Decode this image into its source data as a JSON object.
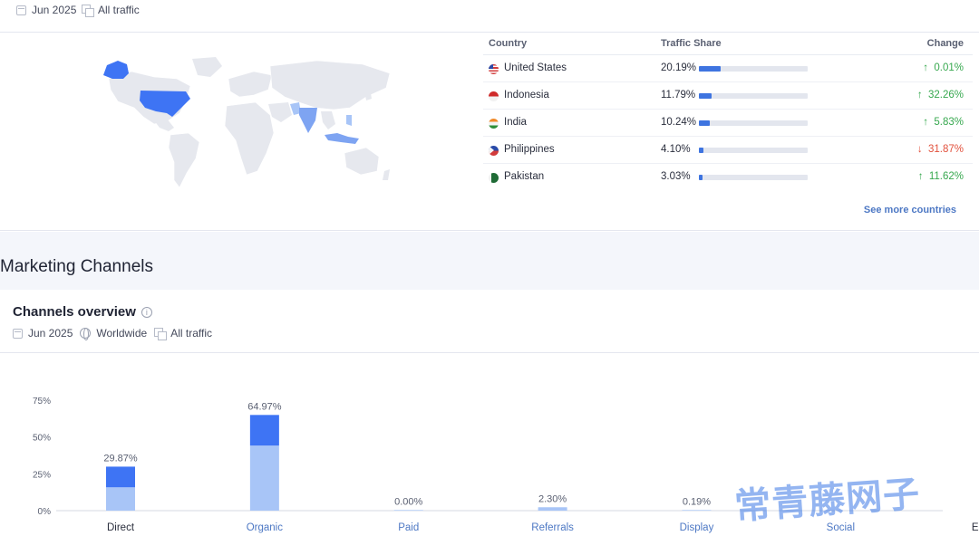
{
  "top_filters": {
    "date": "Jun 2025",
    "traffic": "All traffic"
  },
  "geo": {
    "columns": {
      "country": "Country",
      "share": "Traffic Share",
      "change": "Change"
    },
    "rows": [
      {
        "country": "United States",
        "share": "20.19%",
        "share_value": 20.19,
        "change": "0.01%",
        "direction": "up"
      },
      {
        "country": "Indonesia",
        "share": "11.79%",
        "share_value": 11.79,
        "change": "32.26%",
        "direction": "up"
      },
      {
        "country": "India",
        "share": "10.24%",
        "share_value": 10.24,
        "change": "5.83%",
        "direction": "up"
      },
      {
        "country": "Philippines",
        "share": "4.10%",
        "share_value": 4.1,
        "change": "31.87%",
        "direction": "down"
      },
      {
        "country": "Pakistan",
        "share": "3.03%",
        "share_value": 3.03,
        "change": "11.62%",
        "direction": "up"
      }
    ],
    "see_more": "See more countries"
  },
  "section_title": "Marketing Channels",
  "channels": {
    "title": "Channels overview",
    "filters": {
      "date": "Jun 2025",
      "region": "Worldwide",
      "traffic": "All traffic"
    }
  },
  "chart_data": {
    "type": "bar",
    "categories": [
      "Direct",
      "Organic",
      "Paid",
      "Referrals",
      "Display",
      "Social",
      "Email"
    ],
    "values": [
      29.87,
      64.97,
      0.0,
      2.3,
      0.19,
      null,
      null
    ],
    "value_labels": [
      "29.87%",
      "64.97%",
      "0.00%",
      "2.30%",
      "0.19%",
      "",
      ""
    ],
    "stack_lower_fraction": [
      0.53,
      0.68,
      1,
      1,
      1,
      1,
      1
    ],
    "y_ticks": [
      "0%",
      "25%",
      "50%",
      "75%"
    ],
    "ylim": [
      0,
      75
    ],
    "colors": {
      "dark": "#3e74f4",
      "light": "#a8c5f7"
    }
  },
  "watermark": "常青藤网子"
}
